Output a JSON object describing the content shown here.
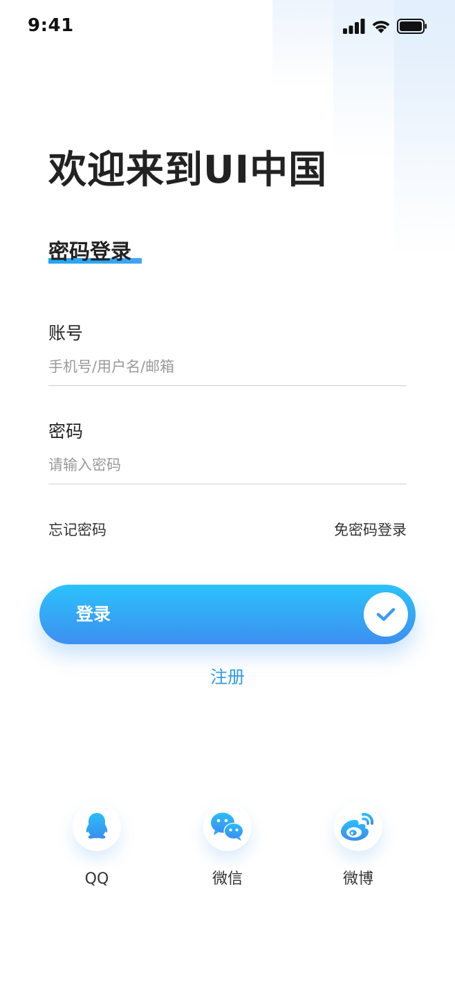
{
  "status_bar": {
    "time": "9:41",
    "icons": [
      "signal-icon",
      "wifi-icon",
      "battery-icon"
    ]
  },
  "header": {
    "welcome_title": "欢迎来到UI中国",
    "mode_title": "密码登录"
  },
  "form": {
    "account": {
      "label": "账号",
      "placeholder": "手机号/用户名/邮箱",
      "value": ""
    },
    "password": {
      "label": "密码",
      "placeholder": "请输入密码",
      "value": ""
    },
    "forgot_password": "忘记密码",
    "passwordless_login": "免密码登录"
  },
  "actions": {
    "login_label": "登录",
    "register_label": "注册"
  },
  "social": {
    "items": [
      {
        "label": "QQ",
        "icon": "qq-icon"
      },
      {
        "label": "微信",
        "icon": "wechat-icon"
      },
      {
        "label": "微博",
        "icon": "weibo-icon"
      }
    ]
  },
  "colors": {
    "accent": "#2f9be8",
    "button_top": "#2bc2fb",
    "button_bottom": "#3d8ff0",
    "text": "#222222",
    "placeholder": "#9a9a9a"
  }
}
